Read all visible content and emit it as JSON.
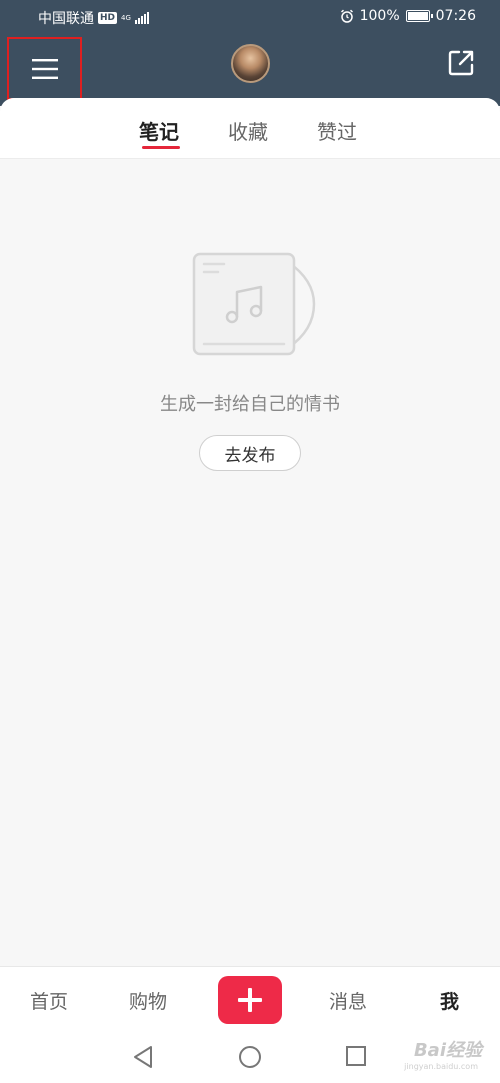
{
  "status_bar": {
    "carrier": "中国联通",
    "hd": "HD",
    "network": "4G",
    "battery": "100%",
    "battery_level": 1.0,
    "time": "07:26",
    "icons": [
      "signal-icon",
      "alarm-icon",
      "battery-icon"
    ]
  },
  "header": {
    "icons": [
      "menu-icon",
      "avatar",
      "share-icon"
    ]
  },
  "tabs": [
    {
      "label": "笔记",
      "active": true
    },
    {
      "label": "收藏",
      "active": false
    },
    {
      "label": "赞过",
      "active": false
    }
  ],
  "empty_state": {
    "icon": "music-album-icon",
    "message": "生成一封给自己的情书",
    "button": "去发布"
  },
  "bottom_nav": {
    "items": [
      {
        "label": "首页",
        "active": false
      },
      {
        "label": "购物",
        "active": false
      },
      {
        "label": "消息",
        "active": false
      },
      {
        "label": "我",
        "active": true
      }
    ],
    "add_icon": "plus-icon"
  },
  "system_nav": [
    "back-icon",
    "home-icon",
    "recents-icon"
  ],
  "watermark": {
    "text": "Bai经验",
    "sub": "jingyan.baidu.com"
  },
  "colors": {
    "header": "#3d4f60",
    "accent": "#e5263a",
    "add_button": "#ee2a48"
  }
}
